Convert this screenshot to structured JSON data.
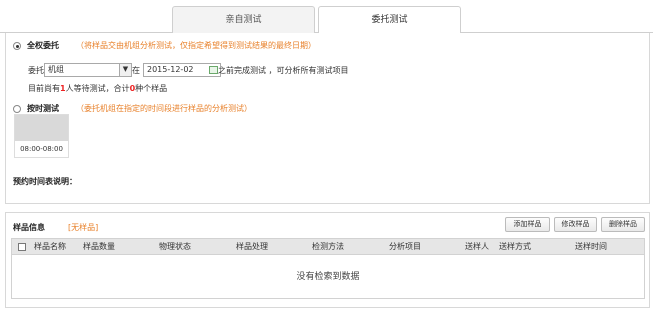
{
  "tabs": [
    {
      "label": "亲自测试",
      "active": false
    },
    {
      "label": "委托测试",
      "active": true
    }
  ],
  "entrust": {
    "full_label": "全权委托",
    "full_note": "（将样品交由机组分析测试，仅指定希望得到测试结果的最终日期）",
    "prefix": "委托",
    "select_value": "机组",
    "at": "在",
    "date_value": "2015-12-02",
    "after_date": "之前完成测试 ，可分析所有测试项目",
    "queue_prefix": "目前尚有",
    "queue_people": "1",
    "queue_mid": "人等待测试，合计",
    "queue_samples": "0",
    "queue_suffix": "种个样品",
    "timed_label": "按时测试",
    "timed_note": "（委托机组在指定的时间段进行样品的分析测试）",
    "time_slot": "08:00-08:00",
    "schedule_label": "预约时间表说明："
  },
  "samples": {
    "title": "样品信息",
    "status": "[无样品]",
    "buttons": {
      "add": "添加样品",
      "edit": "修改样品",
      "delete": "删除样品"
    },
    "columns": [
      "样品名称",
      "样品数量",
      "物理状态",
      "样品处理",
      "检测方法",
      "分析项目",
      "送样人",
      "送样方式",
      "送样时间"
    ],
    "empty_text": "没有检索到数据"
  },
  "colors": {
    "accent_orange": "#e8802a",
    "count_red": "#ee2222"
  }
}
